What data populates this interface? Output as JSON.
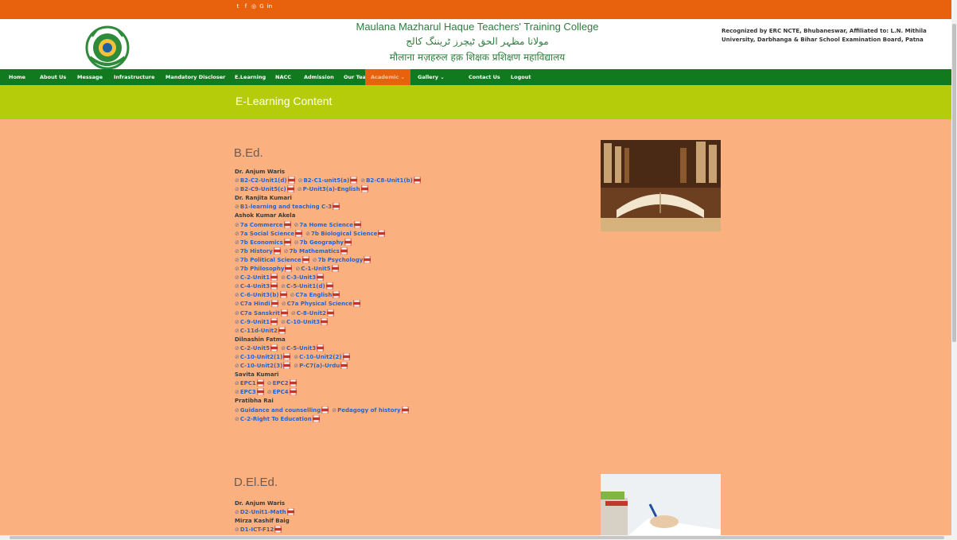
{
  "social": [
    "twitter-icon",
    "facebook-icon",
    "instagram-icon",
    "google-icon",
    "linkedin-icon"
  ],
  "college": {
    "name_en": "Maulana Mazharul Haque Teachers' Training College",
    "name_ur": "مولانا مظہر الحق ٹیچرز ٹریننگ کالج",
    "name_hi": "मौलाना मज़हरुल हक़ शिक्षक प्रशिक्षण महाविद्यालय",
    "recognition": "Recognized by ERC NCTE, Bhubaneswar, Affiliated to: L.N. Mithila University, Darbhanga & Bihar School Examination Board, Patna"
  },
  "nav": [
    {
      "label": "Home"
    },
    {
      "label": "About Us"
    },
    {
      "label": "Message"
    },
    {
      "label": "Infrastructure"
    },
    {
      "label": "Mandatory Discloser"
    },
    {
      "label": "E.Learning"
    },
    {
      "label": "NACC"
    },
    {
      "label": "Admission"
    },
    {
      "label": "Our Team"
    },
    {
      "label": "Academic ⌄"
    },
    {
      "label": "Gallery ⌄"
    },
    {
      "label": "Contact Us"
    },
    {
      "label": "Logout"
    }
  ],
  "banner_title": "E-Learning Content",
  "sections": [
    {
      "title": "B.Ed.",
      "lines": [
        {
          "teacher": "Dr. Anjum Waris"
        },
        {
          "items": [
            "B2-C2-Unit1(d)",
            "B2-C1-unit5(a)",
            "B2-C8-Unit1(b)"
          ]
        },
        {
          "items": [
            "B2-C9-Unit5(c)",
            "P-Unit3(a)-English"
          ]
        },
        {
          "teacher": "Dr. Ranjita Kumari"
        },
        {
          "items": [
            "B1-learning and teaching C-3"
          ]
        },
        {
          "teacher": "Ashok Kumar Akela"
        },
        {
          "items": [
            "7a Commerce",
            "7a Home Science"
          ]
        },
        {
          "items": [
            "7a Social Science",
            "7b Biological Science"
          ]
        },
        {
          "items": [
            "7b Economics",
            "7b Geography"
          ]
        },
        {
          "items": [
            "7b History",
            "7b Mathematics"
          ]
        },
        {
          "items": [
            "7b Political Science",
            "7b Psychology"
          ]
        },
        {
          "items": [
            "7b Philosophy",
            "C-1-Unit5"
          ]
        },
        {
          "items": [
            "C-2-Unit1",
            "C-3-Unit3"
          ]
        },
        {
          "items": [
            "C-4-Unit3",
            "C-5-Unit1(d)"
          ]
        },
        {
          "items": [
            "C-6-Unit3(b)",
            "C7a English"
          ]
        },
        {
          "items": [
            "C7a Hindi",
            "C7a Physical Science"
          ]
        },
        {
          "items": [
            "C7a Sanskrit",
            "C-8-Unit2"
          ]
        },
        {
          "items": [
            "C-9-Unit1",
            "C-10-Unit3"
          ]
        },
        {
          "items": [
            "C-11d-Unit2"
          ]
        },
        {
          "teacher": "Dilnashin Fatma"
        },
        {
          "items": [
            "C-2-Unit5",
            "C-5-Unit3"
          ]
        },
        {
          "items": [
            "C-10-Unit2(1)",
            "C-10-Unit2(2)"
          ]
        },
        {
          "items": [
            "C-10-Unit2(3)",
            "P-C7(a)-Urdu"
          ]
        },
        {
          "teacher": "Savita Kumari"
        },
        {
          "items": [
            "EPC1",
            "EPC2"
          ]
        },
        {
          "items": [
            "EPC3",
            "EPC4"
          ]
        },
        {
          "teacher": "Pratibha Rai"
        },
        {
          "items": [
            "Guidance and counselling",
            "Pedagogy of history"
          ]
        },
        {
          "items": [
            "C-2-Right To Education"
          ]
        }
      ]
    },
    {
      "title": "D.El.Ed.",
      "lines": [
        {
          "teacher": "Dr. Anjum Waris"
        },
        {
          "items": [
            "D2-Unit1-Math"
          ]
        },
        {
          "teacher": "Mirza Kashif Baig"
        },
        {
          "items": [
            "D1-ICT-F12"
          ]
        }
      ]
    }
  ],
  "colors": {
    "topbar": "#e8620e",
    "nav": "#117a1f",
    "banner": "#b5cc0a",
    "page": "#fbb17f",
    "link": "#2b63c9"
  }
}
